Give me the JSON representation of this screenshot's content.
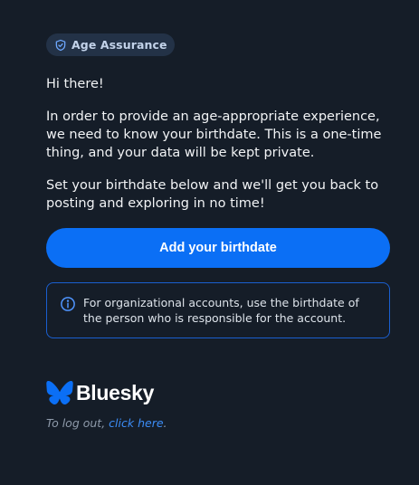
{
  "badge": {
    "label": "Age Assurance",
    "icon": "shield-check-icon"
  },
  "body": {
    "greeting": "Hi there!",
    "paragraph_1": "In order to provide an age-appropriate experience, we need to know your birthdate. This is a one-time thing, and your data will be kept private.",
    "paragraph_2": "Set your birthdate below and we'll get you back to posting and exploring in no time!"
  },
  "cta": {
    "label": "Add your birthdate"
  },
  "notice": {
    "icon": "info-circle-icon",
    "text": "For organizational accounts, use the birthdate of the person who is responsible for the account."
  },
  "brand": {
    "name": "Bluesky",
    "icon": "butterfly-logo-icon",
    "color": "#0b6ff5"
  },
  "logout": {
    "prefix": "To log out, ",
    "link": "click here",
    "suffix": "."
  },
  "colors": {
    "background": "#151d28",
    "accent": "#0b6ff5",
    "badge_bg": "#233247",
    "notice_border": "#1a5fd0",
    "muted_text": "#8f9bab"
  }
}
